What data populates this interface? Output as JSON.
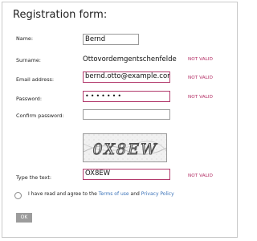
{
  "form": {
    "title": "Registration form:",
    "fields": {
      "name": {
        "label": "Name:",
        "value": "Bernd"
      },
      "surname": {
        "label": "Surname:",
        "value": "Ottovordemgentschenfelde",
        "status": "NOT VALID"
      },
      "email": {
        "label": "Email address:",
        "value": "bernd.otto@example.com",
        "status": "NOT VALID"
      },
      "password": {
        "label": "Password:",
        "value": "•••••••",
        "status": "NOT VALID"
      },
      "confirm_password": {
        "label": "Confirm password:",
        "value": ""
      },
      "captcha_text": {
        "label": "Type the text:",
        "value": "OX8EW",
        "status": "NOT VALID"
      }
    },
    "captcha_image_text": "0X8EW",
    "agree": {
      "prefix": "I have read and agree to the",
      "terms_link": "Terms of use",
      "and": "and",
      "privacy_link": "Privacy Policy"
    },
    "ok_label": "OK"
  },
  "colors": {
    "invalid": "#b22a62",
    "link": "#3a72b8",
    "button_disabled": "#9c9c9c"
  }
}
